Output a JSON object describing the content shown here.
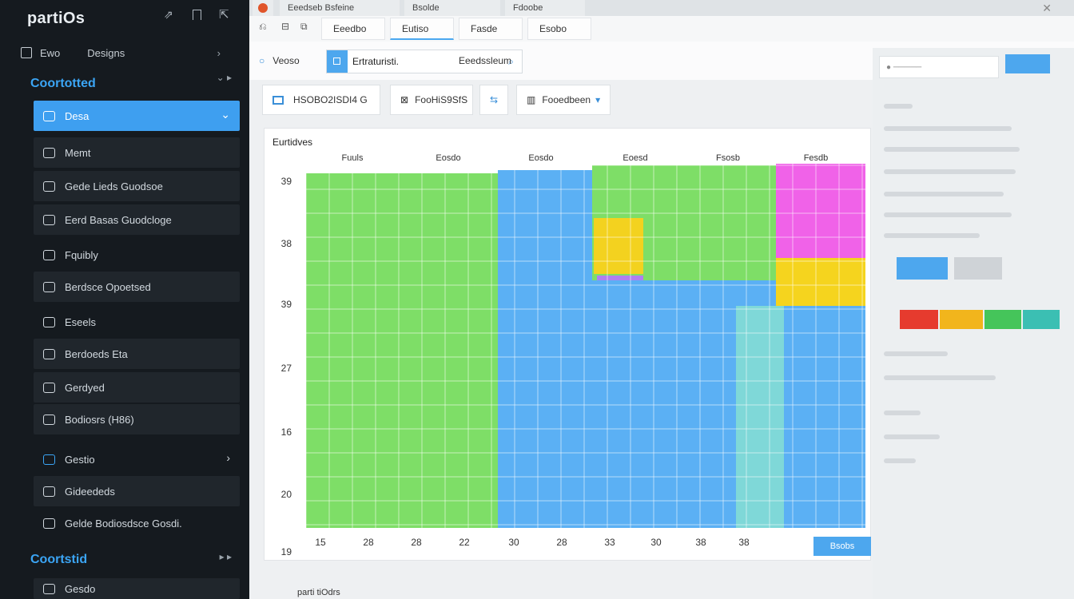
{
  "sidebar": {
    "brand": "partiOs",
    "top_row": {
      "left": "Ewo",
      "right": "Designs"
    },
    "section1": {
      "title": "Coortotted"
    },
    "items": [
      {
        "label": "Desa",
        "active": true
      },
      {
        "label": "Memt"
      },
      {
        "label": "Gede Lieds Guodsoe"
      },
      {
        "label": "Eerd Basas Guodcloge"
      },
      {
        "label": "Fquibly"
      },
      {
        "label": "Berdsce Opoetsed"
      },
      {
        "label": "Eseels"
      },
      {
        "label": "Berdoeds Eta"
      },
      {
        "label": "Gerdyed"
      },
      {
        "label": "Bodiosrs (H86)"
      },
      {
        "label": "Gestio"
      },
      {
        "label": "Gideededs"
      },
      {
        "label": "Gelde Bodiosdsce Gosdi."
      }
    ],
    "section2": {
      "title": "Coortstid"
    },
    "bottom_item": "Gesdo"
  },
  "tabs": [
    "Eeedseb Bsfeine",
    "Bsolde",
    "Fdoobe"
  ],
  "toolbar1": {
    "tab1": "Eeedbo",
    "tab2": "Eutiso",
    "tab3": "Fasde",
    "tab4": "Esobo"
  },
  "toolbar2": {
    "left": "Veoso",
    "field": "Ertraturisti.",
    "right": "Eeedssleum"
  },
  "panelbar": {
    "b1": "HSOBO2ISDI4 G",
    "b2": "FooHiS9SfS",
    "b3": "Fooedbeen"
  },
  "chart_data": {
    "type": "heatmap",
    "title": "Eurtidves",
    "column_headers": [
      "Fuuls",
      "Eosdo",
      "Eosdo",
      "Eoesd",
      "Fsosb",
      "Fesdb"
    ],
    "y_tick_labels": [
      "39",
      "38",
      "39",
      "27",
      "16",
      "20",
      "19"
    ],
    "x_tick_labels": [
      "15",
      "28",
      "28",
      "22",
      "30",
      "28",
      "33",
      "30",
      "38",
      "38"
    ],
    "regions": [
      {
        "name": "green-left",
        "color": "#7ede67"
      },
      {
        "name": "blue-mid",
        "color": "#5bb0f4"
      },
      {
        "name": "green-upper-right",
        "color": "#7ede67"
      },
      {
        "name": "yellow-a",
        "color": "#f3d21f"
      },
      {
        "name": "purple",
        "color": "#b07ff0"
      },
      {
        "name": "magenta",
        "color": "#f062e8"
      },
      {
        "name": "yellow-b",
        "color": "#f5d41e"
      },
      {
        "name": "teal",
        "color": "#7fd8d8"
      },
      {
        "name": "blue-right",
        "color": "#5bb0f4"
      }
    ]
  },
  "right_panel": {
    "colors": [
      "#e63b2e",
      "#f2b51c",
      "#45c55a",
      "#3bbfb3"
    ],
    "accent": "#4da7ee"
  },
  "bottom": {
    "button": "Bsobs",
    "label": "parti tiOdrs"
  }
}
